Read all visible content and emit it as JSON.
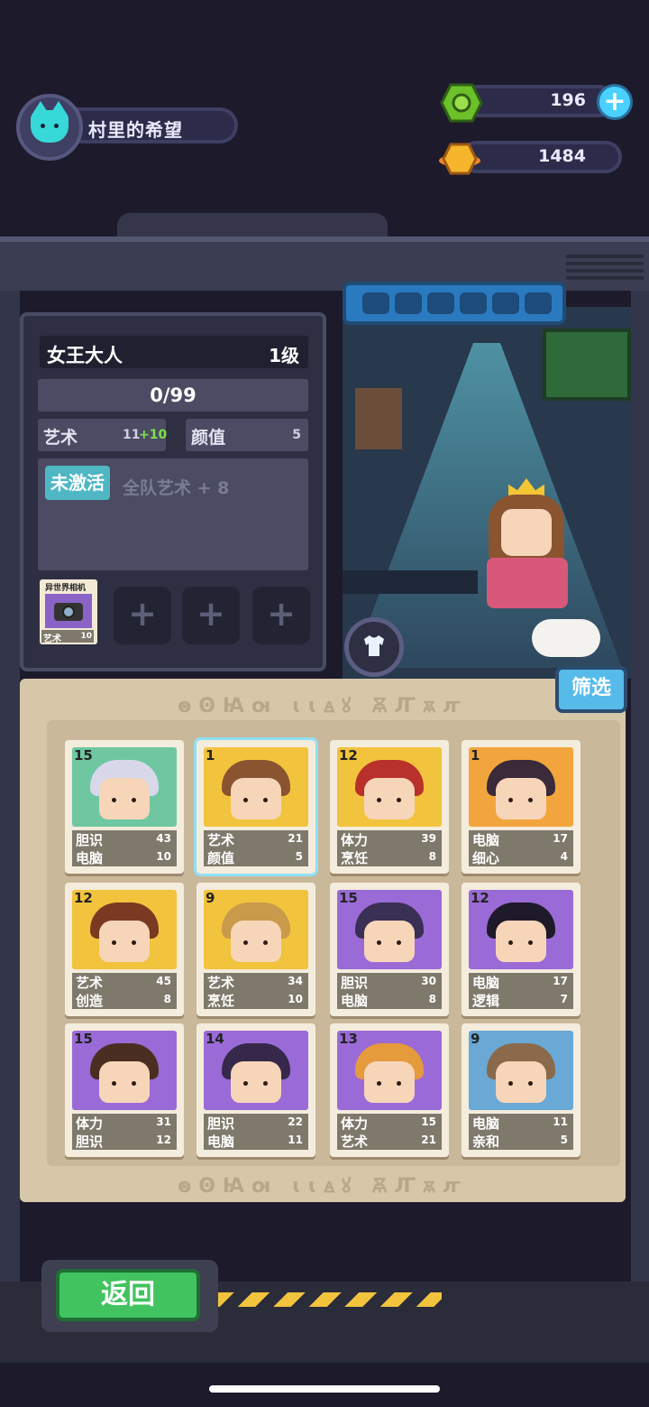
{
  "header": {
    "profile_name": "村里的希望",
    "currency_green": "196",
    "currency_gold": "1484"
  },
  "character": {
    "name": "女王大人",
    "level": "1级",
    "exp": "0/99",
    "stat1_name": "艺术",
    "stat1_value": "11",
    "stat1_bonus": "+10",
    "stat2_name": "颜值",
    "stat2_value": "5",
    "skill_status": "未激活",
    "skill_desc": "全队艺术 + 8"
  },
  "equipment": {
    "item_name": "异世界相机",
    "item_stat": "艺术",
    "item_value": "10",
    "empty_slot": "+"
  },
  "filter_label": "筛选",
  "rune_text": "ꙩꙨꙖꙕ ꙇꙇꙙꙋ ꙚꙤꙛꙥ",
  "back_label": "返回",
  "cards": [
    {
      "level": "15",
      "s1": "胆识",
      "v1": "43",
      "s2": "电脑",
      "v2": "10",
      "bg": "#6fc7a2",
      "hair": "#d8d8ea"
    },
    {
      "level": "1",
      "s1": "艺术",
      "v1": "21",
      "s2": "颜值",
      "v2": "5",
      "bg": "#f2c33c",
      "hair": "#8a5431"
    },
    {
      "level": "12",
      "s1": "体力",
      "v1": "39",
      "s2": "烹饪",
      "v2": "8",
      "bg": "#f2c33c",
      "hair": "#b8312a"
    },
    {
      "level": "1",
      "s1": "电脑",
      "v1": "17",
      "s2": "细心",
      "v2": "4",
      "bg": "#f2a53c",
      "hair": "#3a2a3a"
    },
    {
      "level": "12",
      "s1": "艺术",
      "v1": "45",
      "s2": "创造",
      "v2": "8",
      "bg": "#f2c33c",
      "hair": "#7a3a22"
    },
    {
      "level": "9",
      "s1": "艺术",
      "v1": "34",
      "s2": "烹饪",
      "v2": "10",
      "bg": "#f2c33c",
      "hair": "#c99a4a"
    },
    {
      "level": "15",
      "s1": "胆识",
      "v1": "30",
      "s2": "电脑",
      "v2": "8",
      "bg": "#9a6bd6",
      "hair": "#3a2f55"
    },
    {
      "level": "12",
      "s1": "电脑",
      "v1": "17",
      "s2": "逻辑",
      "v2": "7",
      "bg": "#9a6bd6",
      "hair": "#1e1a2a"
    },
    {
      "level": "15",
      "s1": "体力",
      "v1": "31",
      "s2": "胆识",
      "v2": "12",
      "bg": "#9a6bd6",
      "hair": "#4a2e22"
    },
    {
      "level": "14",
      "s1": "胆识",
      "v1": "22",
      "s2": "电脑",
      "v2": "11",
      "bg": "#9a6bd6",
      "hair": "#35284a"
    },
    {
      "level": "13",
      "s1": "体力",
      "v1": "15",
      "s2": "艺术",
      "v2": "21",
      "bg": "#9a6bd6",
      "hair": "#e59a3c"
    },
    {
      "level": "9",
      "s1": "电脑",
      "v1": "11",
      "s2": "亲和",
      "v2": "5",
      "bg": "#6aa8d6",
      "hair": "#8a6a4a"
    }
  ]
}
